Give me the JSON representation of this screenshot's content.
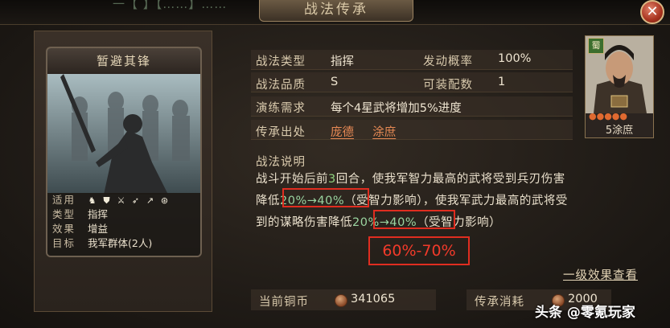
{
  "header": {
    "title": "战法传承",
    "top_text": "一【 】【……】……"
  },
  "card": {
    "name": "暂避其锋",
    "stats": [
      {
        "key": "适用",
        "value": ""
      },
      {
        "key": "类型",
        "value": "指挥"
      },
      {
        "key": "效果",
        "value": "增益"
      },
      {
        "key": "目标",
        "value": "我军群体(2人)"
      }
    ],
    "troop_icons": [
      "cavalry-icon",
      "shield-icon",
      "infantry-icon",
      "bow-icon",
      "spear-icon",
      "siege-icon"
    ]
  },
  "info": {
    "type_label": "战法类型",
    "type_value": "指挥",
    "rate_label": "发动概率",
    "rate_value": "100%",
    "quality_label": "战法品质",
    "quality_value": "S",
    "slots_label": "可装配数",
    "slots_value": "1",
    "drill_label": "演练需求",
    "drill_value": "每个4星武将增加5%进度",
    "source_label": "传承出处",
    "sources": [
      "庞德",
      "涂庶"
    ]
  },
  "general": {
    "faction": "蜀",
    "name": "5涂庶",
    "stars": "●●●●●"
  },
  "description": {
    "title": "战法说明",
    "line1_a": "战斗开始后前",
    "line1_num": "3",
    "line1_b": "回合，使我军智力最高的武将受到兵刃伤害",
    "line2_a": "降低",
    "line2_hl": "20%→40%",
    "line2_b": "（受智力影响），使我军武力最高的武将受",
    "line3_a": "到的谋略伤害降低",
    "line3_hl": "20%→40%",
    "line3_b": "（受智力影响）"
  },
  "annotation": "60%-70%",
  "effect_link": "一级效果查看",
  "footer": {
    "copper_label": "当前铜币",
    "copper_value": "341065",
    "cost_label": "传承消耗",
    "cost_value": "2000"
  },
  "watermark": "头条 @零氪玩家",
  "colors": {
    "accent": "#e88a55",
    "highlight": "#9ad4a0",
    "annotation": "#e02d20"
  }
}
